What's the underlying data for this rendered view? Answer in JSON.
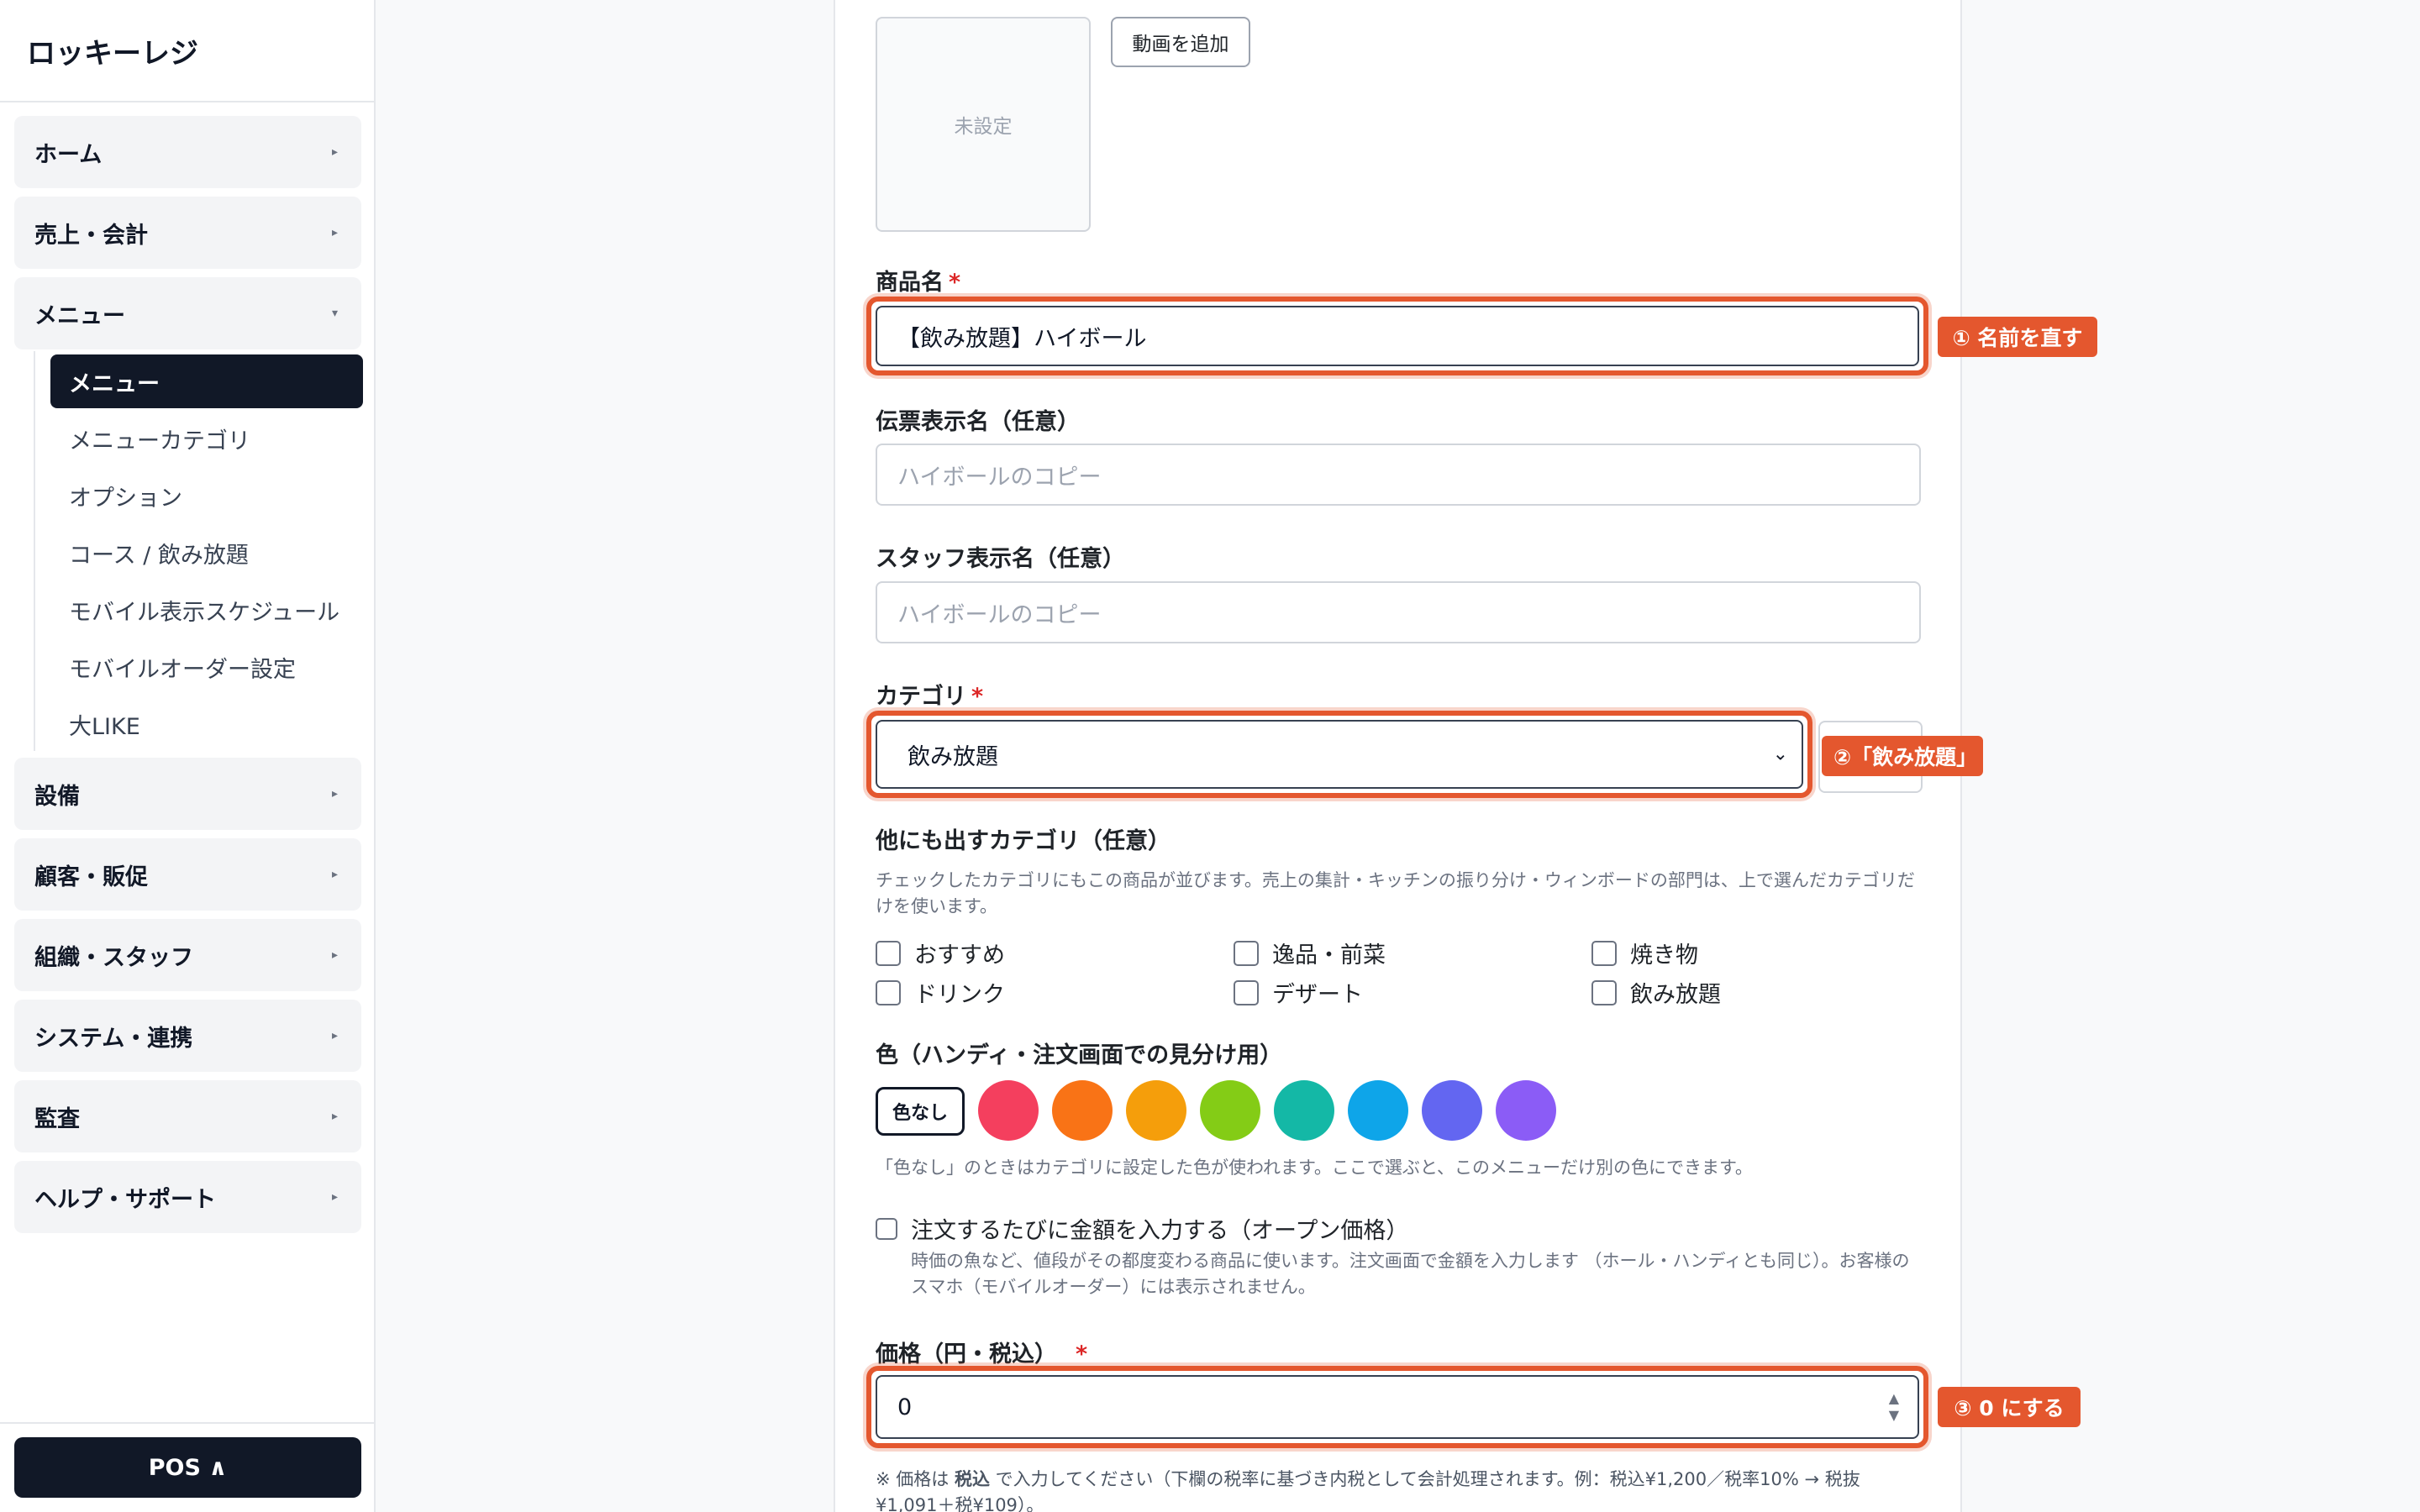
{
  "app": {
    "brand": "ロッキーレジ"
  },
  "sidebar": {
    "groups": [
      {
        "label": "ホーム",
        "chevron": "▸"
      },
      {
        "label": "売上・会計",
        "chevron": "▸"
      },
      {
        "label": "メニュー",
        "chevron": "▾"
      },
      {
        "label": "設備",
        "chevron": "▸"
      },
      {
        "label": "顧客・販促",
        "chevron": "▸"
      },
      {
        "label": "組織・スタッフ",
        "chevron": "▸"
      },
      {
        "label": "システム・連携",
        "chevron": "▸"
      },
      {
        "label": "監査",
        "chevron": "▸"
      },
      {
        "label": "ヘルプ・サポート",
        "chevron": "▸"
      }
    ],
    "menu_sub": [
      {
        "label": "メニュー",
        "active": true
      },
      {
        "label": "メニューカテゴリ"
      },
      {
        "label": "オプション"
      },
      {
        "label": "コース / 飲み放題"
      },
      {
        "label": "モバイル表示スケジュール"
      },
      {
        "label": "モバイルオーダー設定"
      },
      {
        "label": "大LIKE"
      }
    ],
    "pos_button": "POS ∧"
  },
  "form": {
    "image_placeholder": "未設定",
    "add_video": "動画を追加",
    "name": {
      "label": "商品名",
      "required": "*",
      "value": "【飲み放題】ハイボール",
      "callout": "① 名前を直す"
    },
    "slip_name": {
      "label": "伝票表示名（任意）",
      "placeholder": "ハイボールのコピー"
    },
    "staff_name": {
      "label": "スタッフ表示名（任意）",
      "placeholder": "ハイボールのコピー"
    },
    "category": {
      "label": "カテゴリ",
      "required": "*",
      "value": "飲み放題",
      "callout": "②「飲み放題」"
    },
    "other_categories": {
      "label": "他にも出すカテゴリ（任意）",
      "help": "チェックしたカテゴリにもこの商品が並びます。売上の集計・キッチンの振り分け・ウィンボードの部門は、上で選んだカテゴリだけを使います。",
      "options": [
        "おすすめ",
        "逸品・前菜",
        "焼き物",
        "ドリンク",
        "デザート",
        "飲み放題"
      ]
    },
    "color": {
      "label": "色（ハンディ・注文画面での見分け用）",
      "none_label": "色なし",
      "swatches": [
        "#f43f5e",
        "#f97316",
        "#f59e0b",
        "#84cc16",
        "#14b8a6",
        "#0ea5e9",
        "#6366f1",
        "#8b5cf6"
      ],
      "help": "「色なし」のときはカテゴリに設定した色が使われます。ここで選ぶと、このメニューだけ別の色にできます。"
    },
    "open_price": {
      "label": "注文するたびに金額を入力する（オープン価格）",
      "help": "時価の魚など、値段がその都度変わる商品に使います。注文画面で金額を入力します （ホール・ハンディとも同じ）。お客様のスマホ（モバイルオーダー）には表示されません。"
    },
    "price": {
      "label": "価格（円・税込）",
      "required": "*",
      "value": "0",
      "callout": "③ 0 にする",
      "note_prefix": "※ 価格は ",
      "note_bold": "税込",
      "note_rest": " で入力してください（下欄の税率に基づき内税として会計処理されます。例：税込¥1,200／税率10% → 税抜¥1,091＋税¥109）。"
    }
  }
}
